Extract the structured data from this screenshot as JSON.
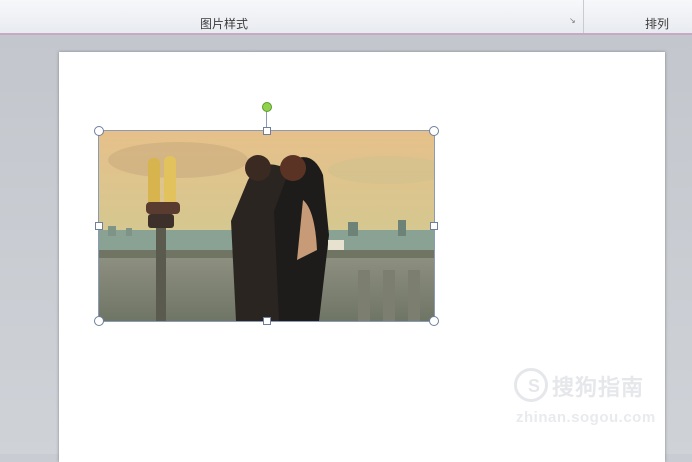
{
  "ribbon": {
    "group_picture_styles": "图片样式",
    "group_arrange": "排列",
    "launcher_icon": "dialog-launcher-icon"
  },
  "selection": {
    "rotation_handle_color": "#8fd34c"
  },
  "watermark": {
    "logo_glyph": "S",
    "title": "搜狗指南",
    "url": "zhinan.sogou.com"
  }
}
